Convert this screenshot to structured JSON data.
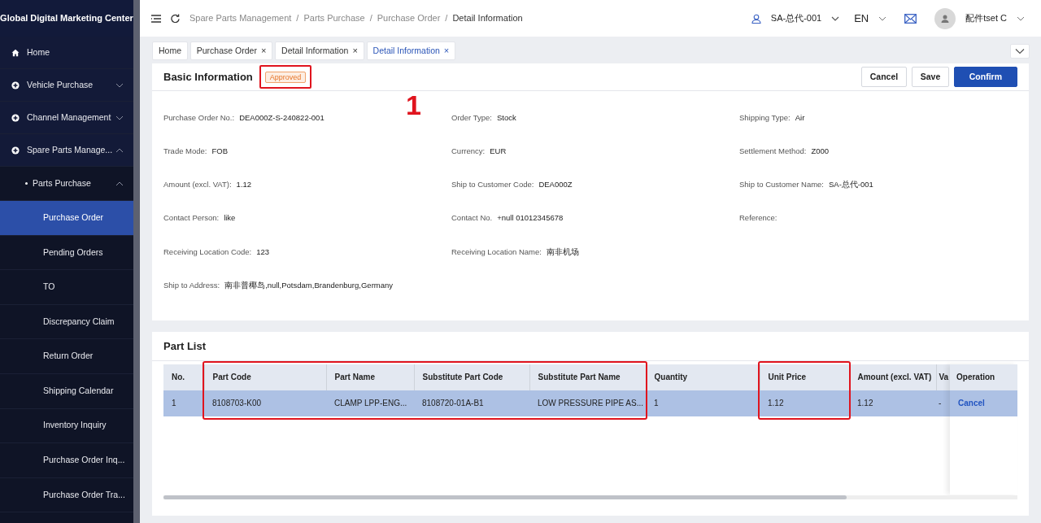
{
  "app_title": "Global Digital Marketing Center",
  "sidebar": {
    "items": [
      {
        "label": "Home",
        "kind": "home",
        "selected": false
      },
      {
        "label": "Vehicle Purchase",
        "kind": "top",
        "expanded": false,
        "selected": false
      },
      {
        "label": "Channel Management",
        "kind": "top",
        "expanded": false,
        "selected": false
      },
      {
        "label": "Spare Parts Manage...",
        "kind": "top",
        "expanded": true,
        "selected": false,
        "children": [
          {
            "label": "Parts Purchase",
            "kind": "sub",
            "expanded": true,
            "selected": false,
            "children": [
              {
                "label": "Purchase Order",
                "kind": "leaf",
                "selected": true
              },
              {
                "label": "Pending Orders",
                "kind": "leaf",
                "selected": false
              },
              {
                "label": "TO",
                "kind": "leaf",
                "selected": false
              },
              {
                "label": "Discrepancy Claim",
                "kind": "leaf",
                "selected": false
              },
              {
                "label": "Return Order",
                "kind": "leaf",
                "selected": false
              },
              {
                "label": "Shipping Calendar",
                "kind": "leaf",
                "selected": false
              },
              {
                "label": "Inventory Inquiry",
                "kind": "leaf",
                "selected": false
              },
              {
                "label": "Purchase Order Inq...",
                "kind": "leaf",
                "selected": false
              },
              {
                "label": "Purchase Order Tra...",
                "kind": "leaf",
                "selected": false
              }
            ]
          }
        ]
      }
    ]
  },
  "breadcrumb": [
    {
      "label": "Spare Parts Management",
      "separator": "/"
    },
    {
      "label": "Parts Purchase",
      "separator": "/"
    },
    {
      "label": "Purchase Order",
      "separator": "/"
    },
    {
      "label": "Detail Information"
    }
  ],
  "header": {
    "dealer": "SA-总代-001",
    "language": "EN",
    "user": "配件tset C"
  },
  "tabs": [
    {
      "label": "Home",
      "selected": false
    },
    {
      "label": "Purchase Order",
      "close": "×",
      "selected": false
    },
    {
      "label": "Detail Information",
      "close": "×",
      "selected": false
    },
    {
      "label": "Detail Information",
      "close": "×",
      "selected": true
    }
  ],
  "basic_info": {
    "title": "Basic Information",
    "status": "Approved",
    "status_outlined": true,
    "annotation_label": "1",
    "buttons": [
      {
        "label": "Cancel",
        "primary": false
      },
      {
        "label": "Save",
        "primary": false
      },
      {
        "label": "Confirm",
        "primary": true
      }
    ],
    "fields": [
      {
        "label": "Purchase Order No.:",
        "value": "DEA000Z-S-240822-001"
      },
      {
        "label": "Order Type:",
        "value": "Stock"
      },
      {
        "label": "Shipping Type:",
        "value": "Air"
      },
      {
        "label": "Trade Mode:",
        "value": "FOB"
      },
      {
        "label": "Currency:",
        "value": "EUR"
      },
      {
        "label": "Settlement Method:",
        "value": "Z000"
      },
      {
        "label": "Amount (excl. VAT):",
        "value": "1.12"
      },
      {
        "label": "Ship to Customer Code:",
        "value": "DEA000Z"
      },
      {
        "label": "Ship to Customer Name:",
        "value": "SA-总代-001"
      },
      {
        "label": "Contact Person:",
        "value": "like"
      },
      {
        "label": "Contact No.",
        "value": "+null 01012345678"
      },
      {
        "label": "Reference:"
      },
      {
        "label": "Receiving Location Code:",
        "value": "123"
      },
      {
        "label": "Receiving Location Name:",
        "value": "南非机场"
      },
      {
        "label": "Ship to Address:",
        "value": "南非普椰岛,null,Potsdam,Brandenburg,Germany",
        "new_row": true
      }
    ]
  },
  "part_list": {
    "title": "Part List",
    "columns": [
      {
        "label": "No.",
        "outlined": false
      },
      {
        "label": "Part Code",
        "outlined": true
      },
      {
        "label": "Part Name",
        "outlined": true
      },
      {
        "label": "Substitute Part Code",
        "outlined": true
      },
      {
        "label": "Substitute Part Name",
        "outlined": true
      },
      {
        "label": "Quantity",
        "outlined": false
      },
      {
        "label": "Unit Price",
        "outlined": true
      },
      {
        "label": "Amount (excl. VAT)",
        "outlined": false
      },
      {
        "label": "Va",
        "outlined": false
      }
    ],
    "operation_column": "Operation",
    "rows": [
      {
        "selected": true,
        "cells": [
          "1",
          "8108703-K00",
          "CLAMP LPP-ENG...",
          "8108720-01A-B1",
          "LOW PRESSURE PIPE AS...",
          "1",
          "1.12",
          "1.12",
          "-"
        ],
        "operation": "Cancel"
      }
    ]
  }
}
